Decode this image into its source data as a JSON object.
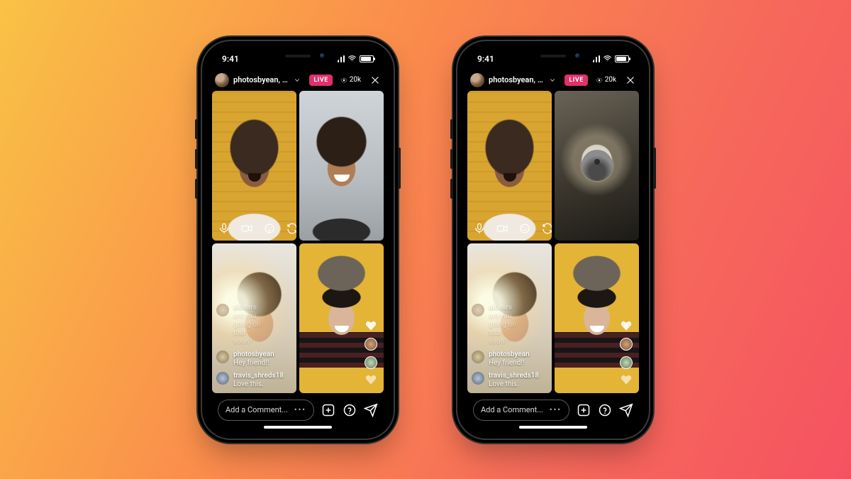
{
  "status": {
    "time": "9:41"
  },
  "header": {
    "hosts_label": "photosbyean, ame...",
    "live_label": "LIVE",
    "viewers": "20k"
  },
  "comments": [
    {
      "user": "aloears",
      "text": "are you going on tour soon?"
    },
    {
      "user": "photosbyean",
      "text": "Hey friend!!"
    },
    {
      "user": "travis_shreds18",
      "text": "Love this."
    }
  ],
  "footer": {
    "placeholder": "Add a Comment...",
    "more": "•••"
  }
}
